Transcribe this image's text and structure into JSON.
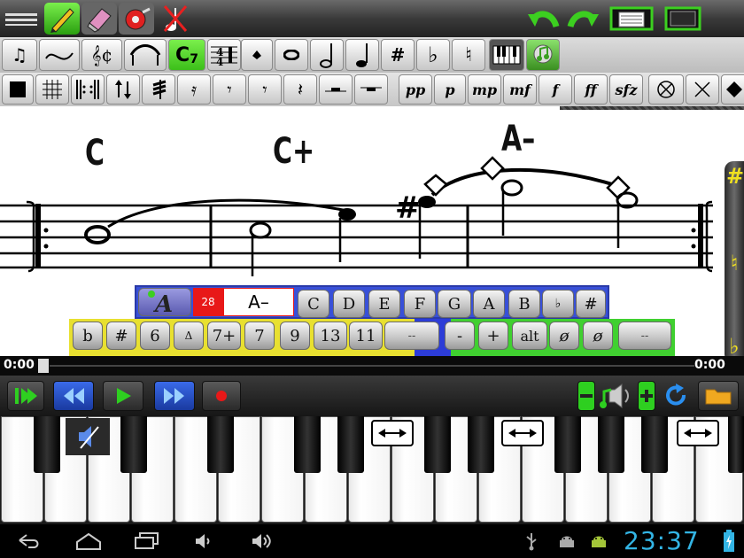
{
  "score": {
    "chords": [
      "C",
      "C+",
      "A–"
    ]
  },
  "chord_panel": {
    "measure": "28",
    "current_chord": "A–",
    "roots": [
      "C",
      "D",
      "E",
      "F",
      "G",
      "A",
      "B",
      "♭",
      "#"
    ],
    "mods": [
      "b",
      "#",
      "6",
      "Δ",
      "7+",
      "7",
      "9",
      "13",
      "11",
      "--",
      "-",
      "+",
      "alt",
      "ø",
      "ø",
      "--"
    ]
  },
  "dynamics": [
    "pp",
    "p",
    "mp",
    "mf",
    "f",
    "ff",
    "sfz"
  ],
  "accidentals": [
    "#",
    "♮",
    "♭"
  ],
  "transport": {
    "time_start": "0:00",
    "time_end": "0:00"
  },
  "status": {
    "clock": "23:37"
  },
  "colors": {
    "selected": "#4ccf20",
    "panel_blue": "#3850d8",
    "clock": "#33b5e5"
  }
}
